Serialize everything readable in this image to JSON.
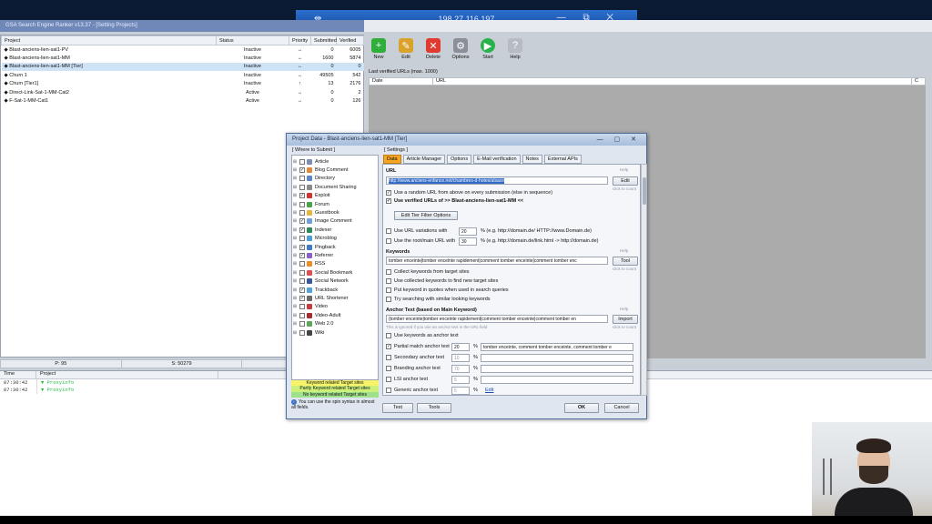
{
  "rdp": {
    "ip": "198.27.116.197",
    "pin_icon": "pin-icon",
    "controls": "— ⧉ ✕"
  },
  "app": {
    "title": "GSA Search Engine Ranker v13.37 - [Setting Projects]"
  },
  "project_table": {
    "columns": [
      "Project",
      "Status",
      "Priority",
      "Submitted",
      "Verified"
    ],
    "rows": [
      {
        "name": "◆ Blast-anciens-lien-sat1-PV",
        "status": "Inactive",
        "priority": "↔",
        "submitted": "0",
        "verified": "6005"
      },
      {
        "name": "◆ Blast-anciens-lien-sat1-MM",
        "status": "Inactive",
        "priority": "↔",
        "submitted": "1600",
        "verified": "5874"
      },
      {
        "name": "    ◆ Blast-anciens-lien-sat1-MM [Tier]",
        "status": "Inactive",
        "priority": "↔",
        "submitted": "0",
        "verified": "0"
      },
      {
        "name": "◆ Churn 1",
        "status": "Inactive",
        "priority": "↔",
        "submitted": "49505",
        "verified": "542"
      },
      {
        "name": "    ◆ Churn [Tier1]",
        "status": "Inactive",
        "priority": "↑",
        "submitted": "13",
        "verified": "2176"
      },
      {
        "name": "◆ Direct-Link-Sat-1-MM-Cat2",
        "status": "Active",
        "priority": "↔",
        "submitted": "0",
        "verified": "2"
      },
      {
        "name": "◆ F-Sat-1-MM-Cat1",
        "status": "Active",
        "priority": "↔",
        "submitted": "0",
        "verified": "126"
      }
    ]
  },
  "statusbar": {
    "p": "P: 95",
    "s": "S: 50279",
    "v": "V: 39873"
  },
  "toolbar": [
    {
      "label": "New",
      "icon": "new-icon",
      "color": "#2fae3a",
      "glyph": "+"
    },
    {
      "label": "Edit",
      "icon": "edit-icon",
      "color": "#d9a22b",
      "glyph": "✎"
    },
    {
      "label": "Delete",
      "icon": "delete-icon",
      "color": "#e03a2e",
      "glyph": "✕"
    },
    {
      "label": "Options",
      "icon": "options-icon",
      "color": "#8a8f98",
      "glyph": "⚙"
    },
    {
      "label": "Start",
      "icon": "start-icon",
      "color": "#27b34a",
      "glyph": "▶"
    },
    {
      "label": "Help",
      "icon": "help-icon",
      "color": "#b7bcc4",
      "glyph": "?"
    }
  ],
  "verified": {
    "label": "Last verified URLs (max. 1000)",
    "col_date": "Date",
    "col_url": "URL",
    "col_c": "C"
  },
  "log": {
    "col_time": "Time",
    "col_project": "Project",
    "rows": [
      {
        "time": "07:30:42",
        "msg": "▼ Proxyinfo"
      },
      {
        "time": "07:30:42",
        "msg": "▼ Proxyinfo"
      }
    ]
  },
  "dialog": {
    "title": "Project Data - Blast-anciens-lien-sat1-MM [Tier]",
    "controls": "— ▢ ✕",
    "where_label": "[ Where to Submit ]",
    "where_items": [
      {
        "label": "Article",
        "checked": false,
        "color": "#7a8fb3"
      },
      {
        "label": "Blog Comment",
        "checked": true,
        "color": "#e08a3a"
      },
      {
        "label": "Directory",
        "checked": false,
        "color": "#5b86c7"
      },
      {
        "label": "Document Sharing",
        "checked": false,
        "color": "#8b8b8b"
      },
      {
        "label": "Exploit",
        "checked": true,
        "color": "#d0342c"
      },
      {
        "label": "Forum",
        "checked": false,
        "color": "#4aa54a"
      },
      {
        "label": "Guestbook",
        "checked": false,
        "color": "#e6b53a"
      },
      {
        "label": "Image Comment",
        "checked": true,
        "color": "#6fa0d8"
      },
      {
        "label": "Indexer",
        "checked": true,
        "color": "#2e8b57"
      },
      {
        "label": "Microblog",
        "checked": false,
        "color": "#4c9ed9"
      },
      {
        "label": "Pingback",
        "checked": true,
        "color": "#3d7cc9"
      },
      {
        "label": "Referrer",
        "checked": true,
        "color": "#8860c8"
      },
      {
        "label": "RSS",
        "checked": false,
        "color": "#f08a24"
      },
      {
        "label": "Social Bookmark",
        "checked": false,
        "color": "#e04e4e"
      },
      {
        "label": "Social Network",
        "checked": false,
        "color": "#3b5998"
      },
      {
        "label": "Trackback",
        "checked": true,
        "color": "#52a3d8"
      },
      {
        "label": "URL Shortener",
        "checked": true,
        "color": "#6a6a6a"
      },
      {
        "label": "Video",
        "checked": false,
        "color": "#c83c3c"
      },
      {
        "label": "Video-Adult",
        "checked": false,
        "color": "#a82a2a"
      },
      {
        "label": "Web 2.0",
        "checked": false,
        "color": "#58a858"
      },
      {
        "label": "Wiki",
        "checked": false,
        "color": "#444444"
      }
    ],
    "legend": [
      {
        "label": "Keyword related Target sites",
        "color": "#f7f36a"
      },
      {
        "label": "Partly Keyword related Target sites",
        "color": "#cdf07a"
      },
      {
        "label": "No keyword related Target sites",
        "color": "#9fe08a"
      }
    ],
    "hint": "You can use the spin syntax in almost all fields.",
    "settings_label": "[ Settings ]",
    "tabs": [
      "Data",
      "Article Manager",
      "Options",
      "E-Mail verification",
      "Notes",
      "External APIs"
    ],
    "url_label": "URL",
    "url_value": "http://www.anciens-enfance.net/chambres-d-hotes/alsace",
    "help_hint": "Help",
    "edit_btn": "Edit",
    "click_hint": "click to count",
    "chk_random_url": "Use a random URL from above on every submission (else in sequence)",
    "chk_verified_urls": "Use verified URLs of >> Blast-anciens-lien-sat1-MM <<",
    "edit_tier_btn": "Edit Tier Filter Options",
    "chk_url_variations": "Use URL variations with",
    "url_variations_value": "20",
    "url_variations_hint": "% (e.g. http://domain.de/ HTTP://www.Domain.de)",
    "chk_root_url": "Use the root/main URL with",
    "root_url_value": "30",
    "root_url_hint": "% (e.g. http://domain.de/link.html -> http://domain.de)",
    "keywords_label": "Keywords",
    "keywords_value": "tomber enceinte|tomber enceinte rapidement|comment tomber enceinte|comment tomber enc",
    "tool_btn": "Tool",
    "chk_collect_kw": "Collect keywords from target sites",
    "chk_use_collected": "Use collected keywords to find new target sites",
    "chk_put_quotes": "Put keyword in quotes when used in search queries",
    "chk_try_similar": "Try searching with similar looking keywords",
    "anchor_label": "Anchor Text (based on Main Keyword)",
    "anchor_value": "{tomber enceinte|tomber enceinte rapidement|comment tomber enceinte|comment tomber en",
    "import_btn": "Import",
    "anchor_ignored": "This is ignored if you use an anchor text in the URL field",
    "chk_kw_anchor": "Use keywords as anchor text",
    "partial_label": "Partial match anchor text",
    "partial_value": "20",
    "partial_text": "tomber enceinte, comment tomber enceinte, comment tomber e",
    "secondary_label": "Secondary anchor text",
    "secondary_value": "10",
    "branding_label": "Branding anchor text",
    "branding_value": "70",
    "lsi_label": "LSI anchor text",
    "lsi_value": "5",
    "generic_label": "Generic anchor text",
    "generic_value": "5",
    "generic_edit": "Edit",
    "percent": "%",
    "test_btn": "Test",
    "tools_btn": "Tools",
    "ok_btn": "OK",
    "cancel_btn": "Cancel"
  }
}
